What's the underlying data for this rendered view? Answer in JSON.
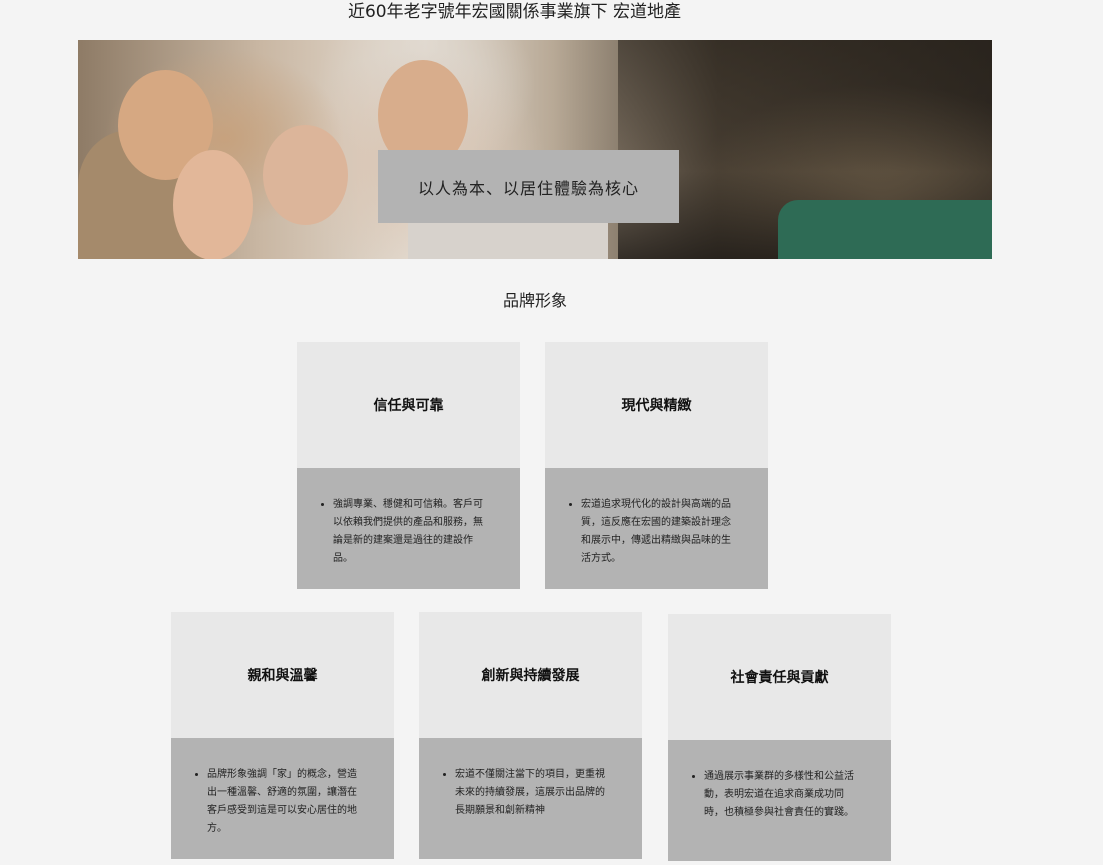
{
  "tagline": "近60年老字號年宏國關係事業旗下  宏道地產",
  "hero": {
    "caption": "以人為本、以居住體驗為核心"
  },
  "section_title": "品牌形象",
  "cards": [
    {
      "title": "信任與可靠",
      "text": "強調專業、穩健和可信賴。客戶可以依賴我們提供的產品和服務，無論是新的建案還是過往的建設作品。"
    },
    {
      "title": "現代與精緻",
      "text": "宏道追求現代化的設計與高端的品質，這反應在宏國的建築設計理念和展示中，傳遞出精緻與品味的生活方式。"
    },
    {
      "title": "親和與溫馨",
      "text": "品牌形象強調「家」的概念，營造出一種溫馨、舒適的氛圍，讓潛在客戶感受到這是可以安心居住的地方。"
    },
    {
      "title": "創新與持續發展",
      "text": "宏道不僅關注當下的項目，更重視未來的持續發展，這展示出品牌的長期願景和創新精神"
    },
    {
      "title": "社會責任與貢獻",
      "text": "通過展示事業群的多樣性和公益活動，表明宏道在追求商業成功同時，也積極參與社會責任的實踐。"
    }
  ]
}
